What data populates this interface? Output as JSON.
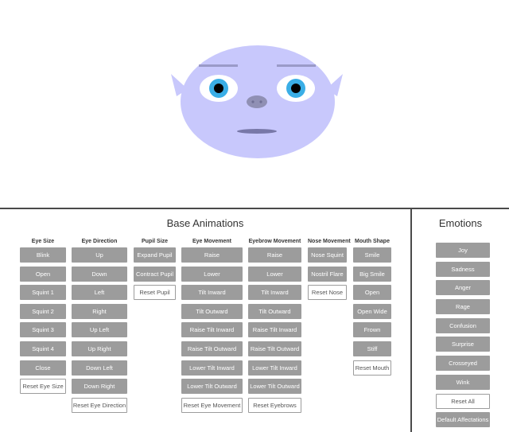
{
  "base": {
    "title": "Base Animations",
    "columns": [
      {
        "header": "Eye Size",
        "buttons": [
          "Blink",
          "Open",
          "Squint 1",
          "Squint 2",
          "Squint 3",
          "Squint 4",
          "Close"
        ],
        "reset": "Reset Eye Size"
      },
      {
        "header": "Eye Direction",
        "buttons": [
          "Up",
          "Down",
          "Left",
          "Right",
          "Up Left",
          "Up Right",
          "Down Left",
          "Down Right"
        ],
        "reset": "Reset Eye Direction"
      },
      {
        "header": "Pupil Size",
        "buttons": [
          "Expand Pupil",
          "Contract Pupil"
        ],
        "reset": "Reset Pupil"
      },
      {
        "header": "Eye Movement",
        "buttons": [
          "Raise",
          "Lower",
          "Tilt Inward",
          "Tilt Outward",
          "Raise Tilt Inward",
          "Raise Tilt Outward",
          "Lower Tilt Inward",
          "Lower Tilt Outward"
        ],
        "reset": "Reset Eye Movement"
      },
      {
        "header": "Eyebrow Movement",
        "buttons": [
          "Raise",
          "Lower",
          "Tilt Inward",
          "Tilt Outward",
          "Raise Tilt Inward",
          "Raise Tilt Outward",
          "Lower Tilt Inward",
          "Lower Tilt Outward"
        ],
        "reset": "Reset Eyebrows"
      },
      {
        "header": "Nose Movement",
        "buttons": [
          "Nose Squint",
          "Nostril Flare"
        ],
        "reset": "Reset Nose"
      },
      {
        "header": "Mouth Shape",
        "buttons": [
          "Smile",
          "Big Smile",
          "Open",
          "Open Wide",
          "Frown",
          "Stiff"
        ],
        "reset": "Reset Mouth"
      }
    ]
  },
  "emotions": {
    "title": "Emotions",
    "buttons": [
      "Joy",
      "Sadness",
      "Anger",
      "Rage",
      "Confusion",
      "Surprise",
      "Crosseyed",
      "Wink"
    ],
    "reset": "Reset All",
    "default": "Default Affectations"
  },
  "colors": {
    "face": "#c8c8fc",
    "iris": "#3aaee6",
    "brow": "#9a9ac8",
    "nose": "#9090b4",
    "mouth": "#7878a8",
    "button": "#9c9c9c"
  }
}
